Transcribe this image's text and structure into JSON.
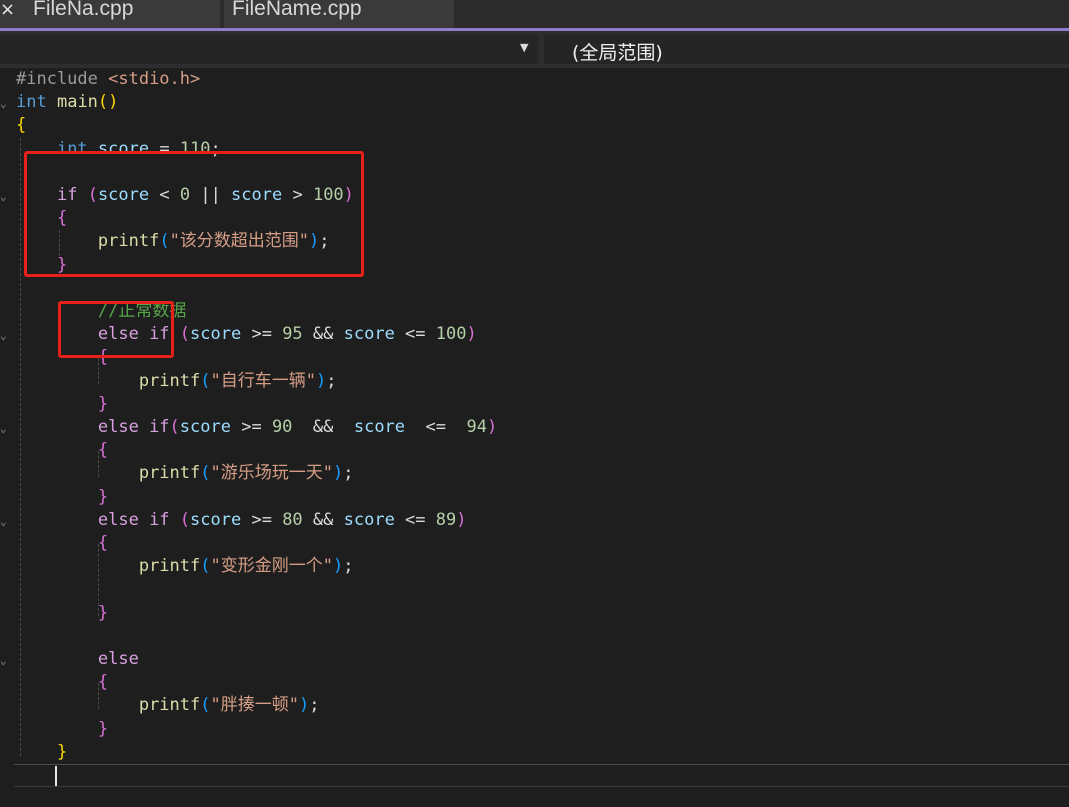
{
  "tabs": [
    {
      "label": "FileNa.cpp",
      "close_icon": "×"
    },
    {
      "label": "FileName.cpp"
    }
  ],
  "navbar": {
    "left_dropdown_icon": "chevron-down-icon",
    "scope_label": "(全局范围)"
  },
  "colors": {
    "accent": "#8f7ccf",
    "highlight_box": "#e8201a",
    "keyword": "#569cd6",
    "control": "#d8a0df",
    "variable": "#9cdcfe",
    "number": "#b5cea8",
    "string": "#d69d85",
    "comment": "#57a64a"
  },
  "code": {
    "lines": [
      [
        [
          "pp",
          "#include "
        ],
        [
          "str",
          "<stdio.h>"
        ]
      ],
      [
        [
          "kw",
          "int"
        ],
        [
          "op",
          " "
        ],
        [
          "fn",
          "main"
        ],
        [
          "br",
          "()"
        ]
      ],
      [
        [
          "br",
          "{"
        ]
      ],
      [
        [
          "op",
          "    "
        ],
        [
          "kw",
          "int"
        ],
        [
          "op",
          " "
        ],
        [
          "var",
          "score"
        ],
        [
          "op",
          " = "
        ],
        [
          "num",
          "110"
        ],
        [
          "op",
          ";"
        ]
      ],
      [
        [
          "op",
          ""
        ]
      ],
      [
        [
          "op",
          "    "
        ],
        [
          "ctl",
          "if"
        ],
        [
          "op",
          " "
        ],
        [
          "br2",
          "("
        ],
        [
          "var",
          "score"
        ],
        [
          "op",
          " < "
        ],
        [
          "num",
          "0"
        ],
        [
          "op",
          " || "
        ],
        [
          "var",
          "score"
        ],
        [
          "op",
          " > "
        ],
        [
          "num",
          "100"
        ],
        [
          "br2",
          ")"
        ]
      ],
      [
        [
          "op",
          "    "
        ],
        [
          "br2",
          "{"
        ]
      ],
      [
        [
          "op",
          "        "
        ],
        [
          "fn",
          "printf"
        ],
        [
          "br3",
          "("
        ],
        [
          "str",
          "\"该分数超出范围\""
        ],
        [
          "br3",
          ")"
        ],
        [
          "op",
          ";"
        ]
      ],
      [
        [
          "op",
          "    "
        ],
        [
          "br2",
          "}"
        ]
      ],
      [
        [
          "op",
          ""
        ]
      ],
      [
        [
          "op",
          "        "
        ],
        [
          "com",
          "//正常数据"
        ]
      ],
      [
        [
          "op",
          "        "
        ],
        [
          "ctl",
          "else if"
        ],
        [
          "op",
          " "
        ],
        [
          "br2",
          "("
        ],
        [
          "var",
          "score"
        ],
        [
          "op",
          " >= "
        ],
        [
          "num",
          "95"
        ],
        [
          "op",
          " && "
        ],
        [
          "var",
          "score"
        ],
        [
          "op",
          " <= "
        ],
        [
          "num",
          "100"
        ],
        [
          "br2",
          ")"
        ]
      ],
      [
        [
          "op",
          "        "
        ],
        [
          "br2",
          "{"
        ]
      ],
      [
        [
          "op",
          "            "
        ],
        [
          "fn",
          "printf"
        ],
        [
          "br3",
          "("
        ],
        [
          "str",
          "\"自行车一辆\""
        ],
        [
          "br3",
          ")"
        ],
        [
          "op",
          ";"
        ]
      ],
      [
        [
          "op",
          "        "
        ],
        [
          "br2",
          "}"
        ]
      ],
      [
        [
          "op",
          "        "
        ],
        [
          "ctl",
          "else if"
        ],
        [
          "br2",
          "("
        ],
        [
          "var",
          "score"
        ],
        [
          "op",
          " >= "
        ],
        [
          "num",
          "90"
        ],
        [
          "op",
          "  &&  "
        ],
        [
          "var",
          "score"
        ],
        [
          "op",
          "  <=  "
        ],
        [
          "num",
          "94"
        ],
        [
          "br2",
          ")"
        ]
      ],
      [
        [
          "op",
          "        "
        ],
        [
          "br2",
          "{"
        ]
      ],
      [
        [
          "op",
          "            "
        ],
        [
          "fn",
          "printf"
        ],
        [
          "br3",
          "("
        ],
        [
          "str",
          "\"游乐场玩一天\""
        ],
        [
          "br3",
          ")"
        ],
        [
          "op",
          ";"
        ]
      ],
      [
        [
          "op",
          "        "
        ],
        [
          "br2",
          "}"
        ]
      ],
      [
        [
          "op",
          "        "
        ],
        [
          "ctl",
          "else if"
        ],
        [
          "op",
          " "
        ],
        [
          "br2",
          "("
        ],
        [
          "var",
          "score"
        ],
        [
          "op",
          " >= "
        ],
        [
          "num",
          "80"
        ],
        [
          "op",
          " && "
        ],
        [
          "var",
          "score"
        ],
        [
          "op",
          " <= "
        ],
        [
          "num",
          "89"
        ],
        [
          "br2",
          ")"
        ]
      ],
      [
        [
          "op",
          "        "
        ],
        [
          "br2",
          "{"
        ]
      ],
      [
        [
          "op",
          "            "
        ],
        [
          "fn",
          "printf"
        ],
        [
          "br3",
          "("
        ],
        [
          "str",
          "\"变形金刚一个\""
        ],
        [
          "br3",
          ")"
        ],
        [
          "op",
          ";"
        ]
      ],
      [
        [
          "op",
          ""
        ]
      ],
      [
        [
          "op",
          "        "
        ],
        [
          "br2",
          "}"
        ]
      ],
      [
        [
          "op",
          ""
        ]
      ],
      [
        [
          "op",
          "        "
        ],
        [
          "ctl",
          "else"
        ]
      ],
      [
        [
          "op",
          "        "
        ],
        [
          "br2",
          "{"
        ]
      ],
      [
        [
          "op",
          "            "
        ],
        [
          "fn",
          "printf"
        ],
        [
          "br3",
          "("
        ],
        [
          "str",
          "\"胖揍一顿\""
        ],
        [
          "br3",
          ")"
        ],
        [
          "op",
          ";"
        ]
      ],
      [
        [
          "op",
          "        "
        ],
        [
          "br2",
          "}"
        ]
      ],
      [
        [
          "op",
          "    "
        ],
        [
          "br",
          "}"
        ]
      ]
    ]
  }
}
